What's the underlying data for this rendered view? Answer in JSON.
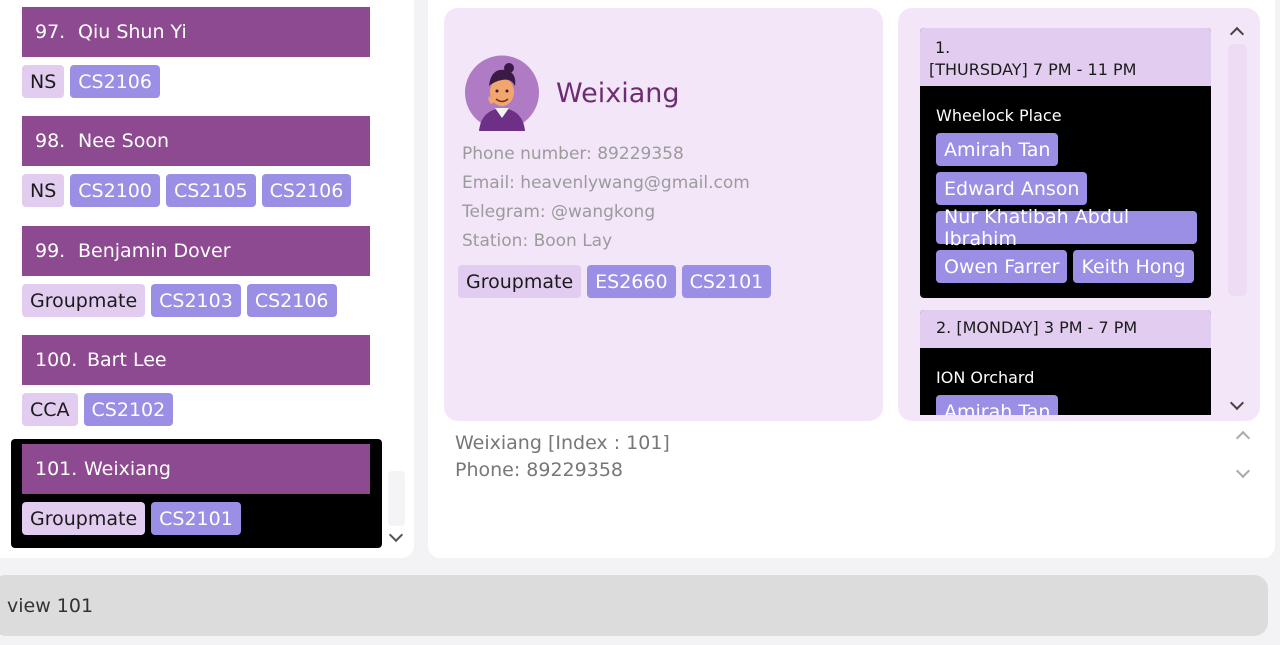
{
  "contacts": [
    {
      "index": "97.",
      "name": "Qiu Shun Yi",
      "categories": [
        "NS"
      ],
      "modules": [
        "CS2106"
      ]
    },
    {
      "index": "98.",
      "name": "Nee Soon",
      "categories": [
        "NS"
      ],
      "modules": [
        "CS2100",
        "CS2105",
        "CS2106"
      ]
    },
    {
      "index": "99.",
      "name": "Benjamin Dover",
      "categories": [
        "Groupmate"
      ],
      "modules": [
        "CS2103",
        "CS2106"
      ]
    },
    {
      "index": "100.",
      "name": "Bart Lee",
      "categories": [
        "CCA"
      ],
      "modules": [
        "CS2102"
      ]
    }
  ],
  "selected_contact": {
    "index": "101.",
    "name": "Weixiang",
    "categories": [
      "Groupmate"
    ],
    "modules": [
      "CS2101"
    ]
  },
  "profile": {
    "name": "Weixiang",
    "phone": "Phone number: 89229358",
    "email": "Email: heavenlywang@gmail.com",
    "telegram": "Telegram: @wangkong",
    "station": "Station: Boon Lay",
    "categories": [
      "Groupmate"
    ],
    "modules": [
      "ES2660",
      "CS2101"
    ]
  },
  "schedule": [
    {
      "number": "1.",
      "time": "[THURSDAY] 7 PM - 11 PM",
      "place": "Wheelock Place",
      "members": [
        "Amirah Tan",
        "Edward Anson",
        "Nur Khatibah Abdul Ibrahim",
        "Owen Farrer",
        "Keith Hong"
      ]
    },
    {
      "number": "2.",
      "time": "[MONDAY] 3 PM - 7 PM",
      "place": "ION Orchard",
      "members": [
        "Amirah Tan"
      ]
    }
  ],
  "result": {
    "line1": "Weixiang [Index : 101]",
    "line2": "Phone: 89229358"
  },
  "command": {
    "value": "view 101"
  },
  "colors": {
    "accent": "#8e4a90",
    "category_tag": "#e2cdf0",
    "module_tag": "#9a8ee5",
    "card_bg": "#f2e6f8"
  }
}
